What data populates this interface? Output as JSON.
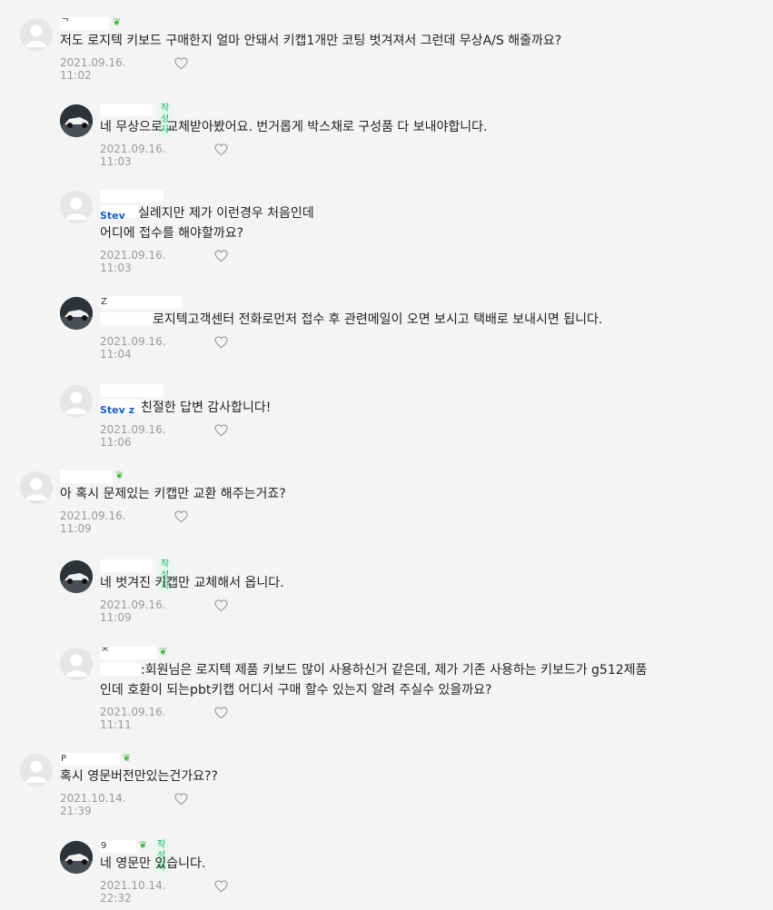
{
  "comments": [
    {
      "level": 0,
      "nick_frag": "ᄀ ",
      "is_author": false,
      "lines": [
        "저도 로지텍 키보드 구매한지 얼마 안돼서 키캡1개만 코팅 벗겨져서 그런데 무상A/S 해줄까요?"
      ],
      "date": "2021.09.16. 11:02"
    },
    {
      "level": 1,
      "nick_frag": "",
      "is_author": true,
      "lines": [
        "네 무상으로 교체받아봤어요. 번거롭게 박스채로 구성품 다 보내야합니다."
      ],
      "date": "2021.09.16. 11:03"
    },
    {
      "level": 1,
      "nick_frag": "",
      "is_author": false,
      "mention": "Stev",
      "lines": [
        "실례지만 제가 이런경우 처음인데",
        "어디에 접수를 해야할까요?"
      ],
      "date": "2021.09.16. 11:03"
    },
    {
      "level": 1,
      "nick_frag": "Z",
      "is_author": false,
      "mention": "",
      "lines": [
        "로지텍고객센터 전화로먼저 접수 후 관련메일이 오면 보시고 택배로 보내시면 됩니다."
      ],
      "date": "2021.09.16. 11:04"
    },
    {
      "level": 1,
      "nick_frag": "",
      "is_author": false,
      "mention": "Stev z",
      "lines": [
        "친절한 답변 감사합니다!"
      ],
      "date": "2021.09.16. 11:06"
    },
    {
      "level": 0,
      "nick_frag": "",
      "is_author": false,
      "lines": [
        "아 혹시 문제있는 키캡만 교환 해주는거죠?"
      ],
      "date": "2021.09.16. 11:09"
    },
    {
      "level": 1,
      "nick_frag": "",
      "is_author": true,
      "lines": [
        "네 벗겨진 키캡만 교체해서 옵니다."
      ],
      "date": "2021.09.16. 11:09"
    },
    {
      "level": 1,
      "nick_frag": "ᄌ",
      "is_author": false,
      "mention": "",
      "lines": [
        ":회원님은 로지텍 제품 키보드 많이 사용하신거 같은데, 제가 기존 사용하는 키보드가 g512제품",
        "인데 호환이 되는pbt키캡 어디서 구매 할수 있는지 알려 주실수 있을까요?"
      ],
      "date": "2021.09.16. 11:11"
    },
    {
      "level": 0,
      "nick_frag": "P",
      "is_author": false,
      "lines": [
        "혹시 영문버전만있는건가요??"
      ],
      "date": "2021.10.14. 21:39"
    },
    {
      "level": 1,
      "nick_frag": "9",
      "is_author": true,
      "lines": [
        "네 영문만 있습니다."
      ],
      "date": "2021.10.14. 22:32"
    }
  ],
  "labels": {
    "author_badge": "작성자"
  },
  "icons": {
    "avatar_default": "person-icon",
    "like": "heart-icon",
    "sprout": "sprout-icon"
  },
  "colors": {
    "background": "#f4f4f4",
    "author_badge": "#15b86a",
    "mention": "#1a5dc2",
    "date": "#9a9a9a"
  }
}
